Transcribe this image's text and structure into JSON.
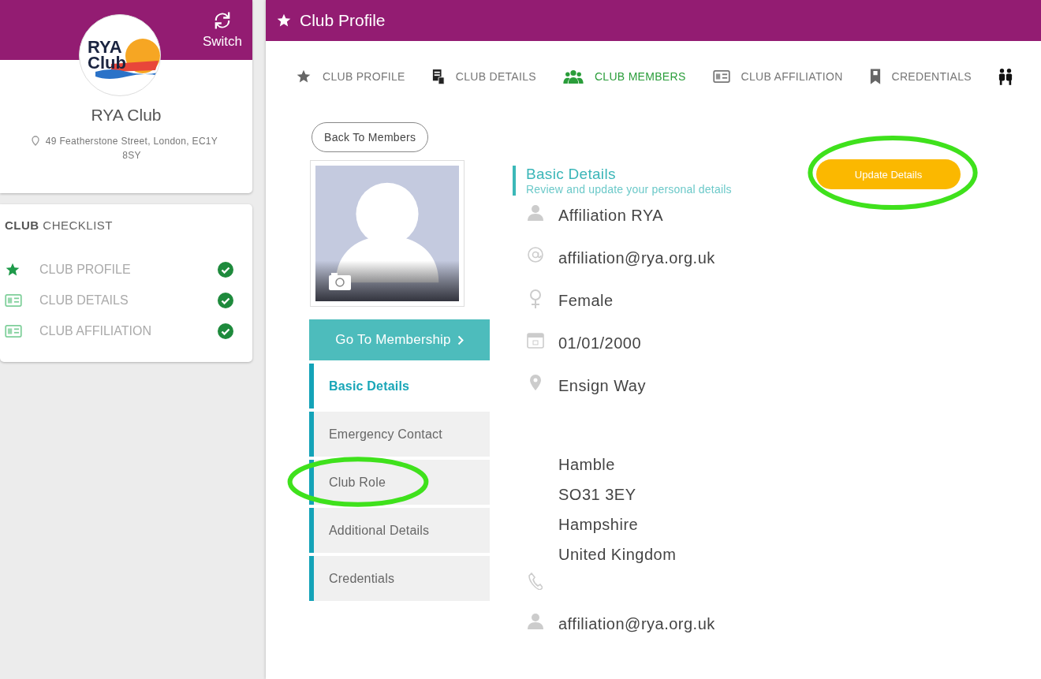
{
  "header": {
    "title": "Club Profile"
  },
  "club": {
    "logo_text": [
      "RYA",
      "Club"
    ],
    "switch_label": "Switch",
    "name": "RYA Club",
    "address": "49 Featherstone Street, London, EC1Y 8SY"
  },
  "checklist": {
    "title": "**CLUB** CHECKLIST",
    "items": [
      {
        "label": "CLUB PROFILE",
        "done": true
      },
      {
        "label": "CLUB DETAILS",
        "done": true
      },
      {
        "label": "CLUB AFFILIATION",
        "done": true
      }
    ]
  },
  "tabs": [
    {
      "label": "CLUB PROFILE",
      "selected": false
    },
    {
      "label": "CLUB DETAILS",
      "selected": false
    },
    {
      "label": "CLUB MEMBERS",
      "selected": true
    },
    {
      "label": "CLUB AFFILIATION",
      "selected": false
    },
    {
      "label": "CREDENTIALS",
      "selected": false
    },
    {
      "selected": false
    }
  ],
  "back_button": "Back To Members",
  "membership_button": "Go To Membership",
  "sections": [
    {
      "label": "Basic Details",
      "selected": true,
      "highlighted": false
    },
    {
      "label": "Emergency Contact",
      "selected": false,
      "highlighted": false
    },
    {
      "label": "Club Role",
      "selected": false,
      "highlighted": true
    },
    {
      "label": "Additional Details",
      "selected": false,
      "highlighted": false
    },
    {
      "label": "Credentials",
      "selected": false,
      "highlighted": false
    }
  ],
  "basic": {
    "title": "Basic Details",
    "subtitle": "Review and update your personal details",
    "update_button": {
      "label": "Update Details",
      "highlighted": true
    },
    "rows": [
      {
        "kind": "person",
        "lines": [
          "Affiliation RYA"
        ]
      },
      {
        "kind": "email",
        "lines": [
          "affiliation@rya.org.uk"
        ]
      },
      {
        "kind": "gender",
        "lines": [
          "Female"
        ]
      },
      {
        "kind": "date",
        "lines": [
          "01/01/2000"
        ]
      },
      {
        "kind": "location",
        "lines": [
          "Ensign Way"
        ]
      },
      {
        "kind": "address",
        "lines": [
          "Hamble",
          "SO31 3EY",
          "Hampshire",
          "United Kingdom"
        ]
      },
      {
        "kind": "phone"
      },
      {
        "kind": "person",
        "lines": [
          "affiliation@rya.org.uk"
        ]
      }
    ]
  }
}
